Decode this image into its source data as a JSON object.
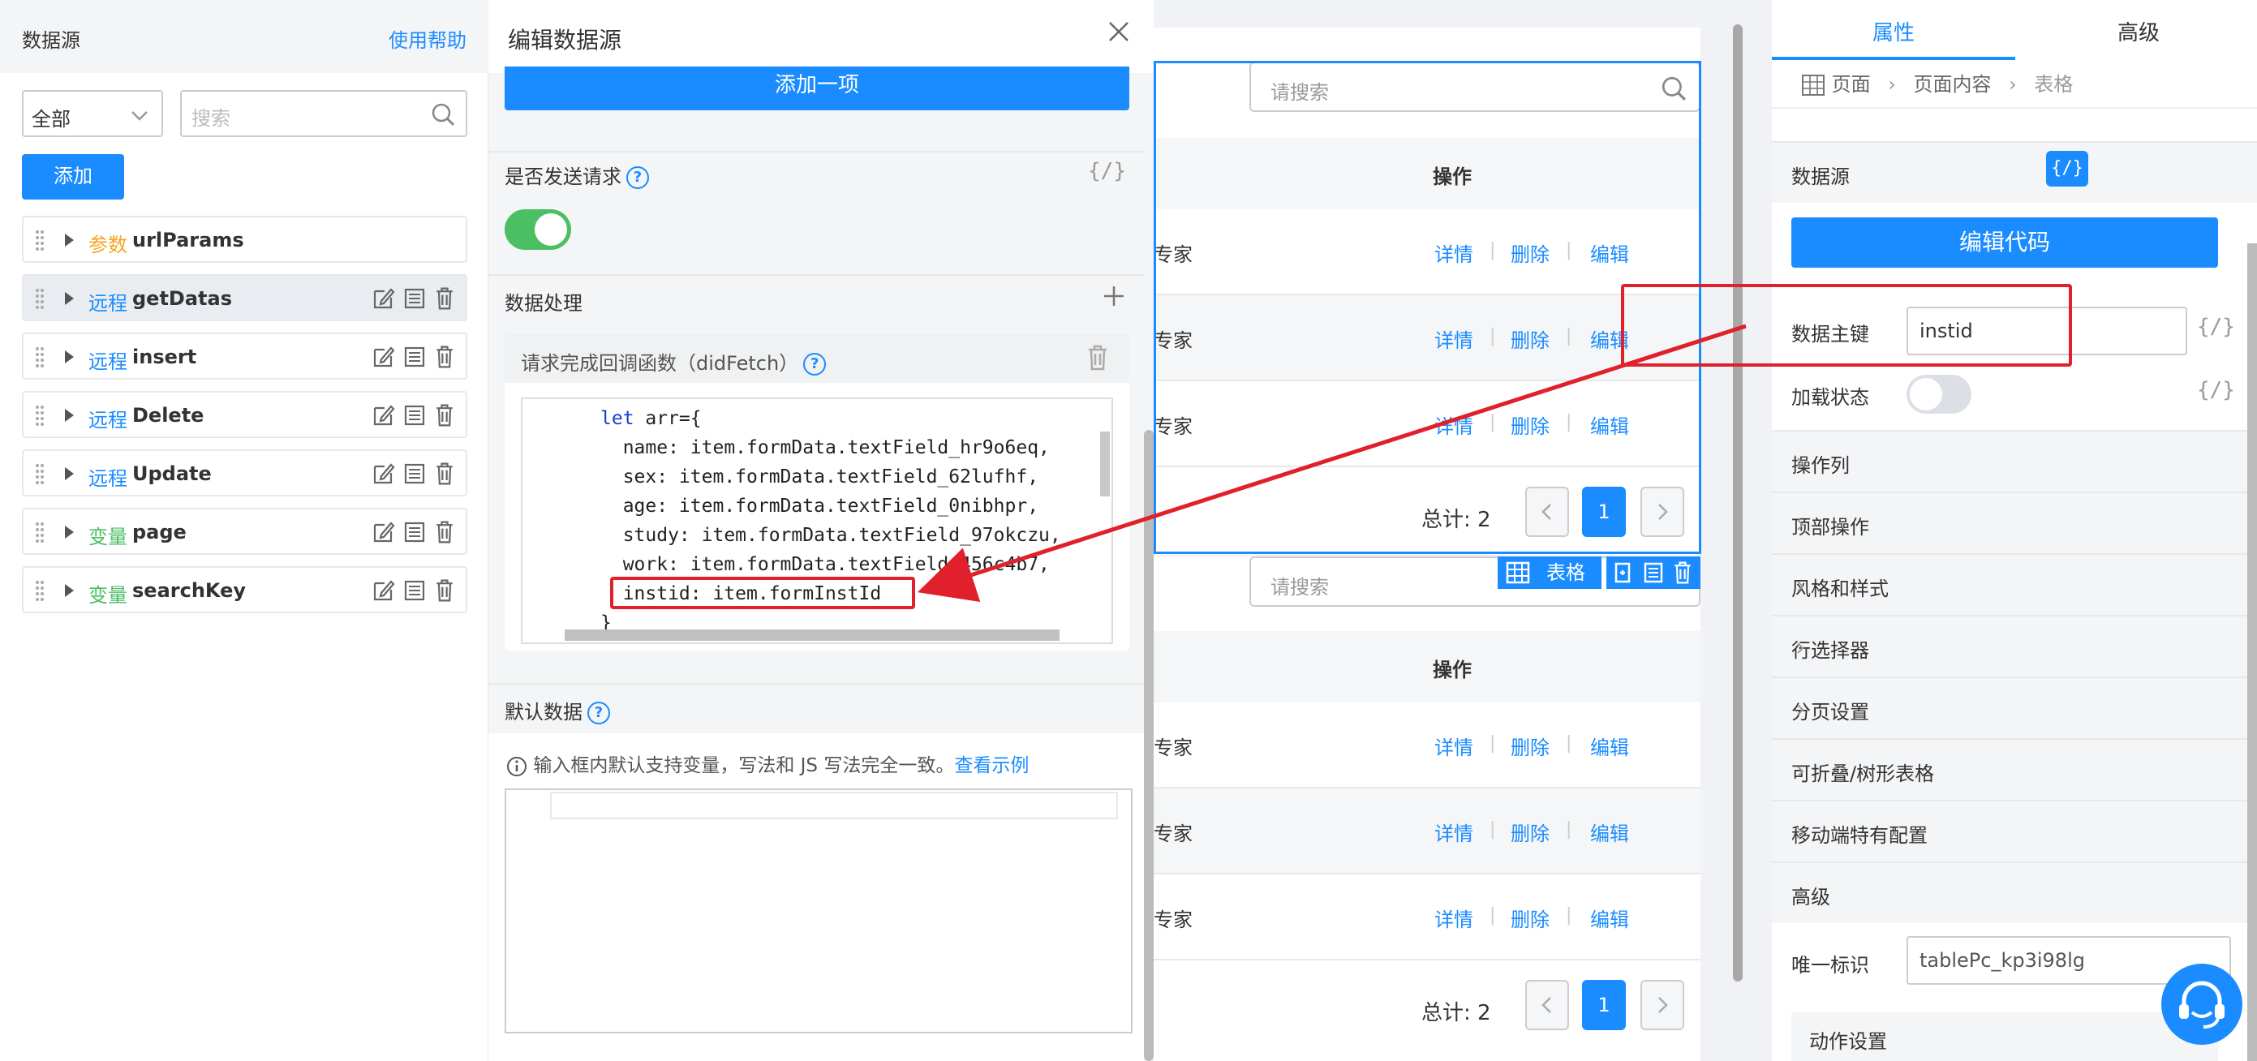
{
  "left": {
    "title": "数据源",
    "help": "使用帮助",
    "filter_value": "全部",
    "search_placeholder": "搜索",
    "add_label": "添加",
    "items": [
      {
        "type": "参数",
        "type_color": "#f5a623",
        "name": "urlParams",
        "selected": false,
        "actions": false
      },
      {
        "type": "远程",
        "type_color": "#1a8cff",
        "name": "getDatas",
        "selected": true,
        "actions": true
      },
      {
        "type": "远程",
        "type_color": "#1a8cff",
        "name": "insert",
        "selected": false,
        "actions": true
      },
      {
        "type": "远程",
        "type_color": "#1a8cff",
        "name": "Delete",
        "selected": false,
        "actions": true
      },
      {
        "type": "远程",
        "type_color": "#1a8cff",
        "name": "Update",
        "selected": false,
        "actions": true
      },
      {
        "type": "变量",
        "type_color": "#4cbe64",
        "name": "page",
        "selected": false,
        "actions": true
      },
      {
        "type": "变量",
        "type_color": "#4cbe64",
        "name": "searchKey",
        "selected": false,
        "actions": true
      }
    ]
  },
  "editor": {
    "title": "编辑数据源",
    "add_item": "添加一项",
    "send_request_label": "是否发送请求",
    "code_toggle": "{/}",
    "data_processing_label": "数据处理",
    "callback_label": "请求完成回调函数（didFetch）",
    "code_lines": [
      "let arr={",
      "  name: item.formData.textField_hr9o6eq,",
      "  sex: item.formData.textField_62lufhf,",
      "  age: item.formData.textField_0nibhpr,",
      "  study: item.formData.textField_97okczu,",
      "  work: item.formData.textField_456c4b7,",
      "  instid: item.formInstId",
      "}"
    ],
    "default_data_label": "默认数据",
    "default_info": "输入框内默认支持变量，写法和 JS 写法完全一致。",
    "default_info_link": "查看示例"
  },
  "canvas": {
    "search_placeholder": "请搜索",
    "op_header": "操作",
    "row_prefix": "专家",
    "link_detail": "详情",
    "link_delete": "删除",
    "link_edit": "编辑",
    "sep": "|",
    "total": "总计: 2",
    "page": "1",
    "table_tag": "表格"
  },
  "right": {
    "tab_props": "属性",
    "tab_advanced": "高级",
    "breadcrumb": [
      "页面",
      "页面内容",
      "表格"
    ],
    "datasource_label": "数据源",
    "code_badge": "{/}",
    "edit_code": "编辑代码",
    "primary_key_label": "数据主键",
    "primary_key_value": "instid",
    "loading_label": "加载状态",
    "sections": [
      "操作列",
      "顶部操作",
      "风格和样式",
      "行选择器",
      "分页设置",
      "可折叠/树形表格",
      "移动端特有配置"
    ],
    "advanced_label": "高级",
    "uid_label": "唯一标识",
    "uid_value": "tablePc_kp3i98lg",
    "action_settings": "动作设置"
  },
  "colors": {
    "primary": "#1a8cff",
    "highlight": "#e0202a",
    "toggle_on": "#4cbe64"
  }
}
